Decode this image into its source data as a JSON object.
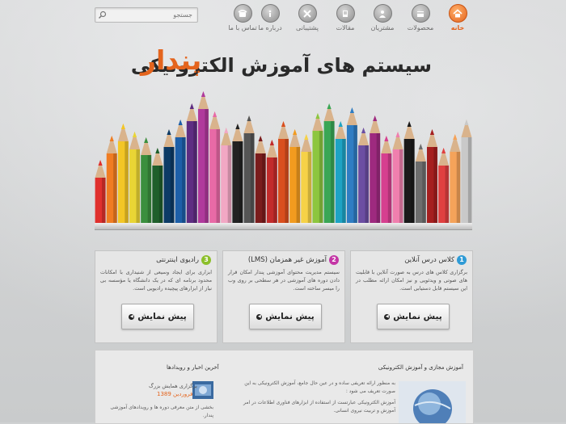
{
  "search": {
    "placeholder": "جستجو"
  },
  "nav": [
    {
      "id": "home",
      "label": "خانه",
      "icon": "home-icon",
      "active": true
    },
    {
      "id": "products",
      "label": "محصولات",
      "icon": "box-icon",
      "active": false
    },
    {
      "id": "customers",
      "label": "مشتریان",
      "icon": "users-icon",
      "active": false
    },
    {
      "id": "articles",
      "label": "مقالات",
      "icon": "article-icon",
      "active": false
    },
    {
      "id": "support",
      "label": "پشتیبانی",
      "icon": "tools-icon",
      "active": false
    },
    {
      "id": "about",
      "label": "درباره ما",
      "icon": "info-icon",
      "active": false
    },
    {
      "id": "contact",
      "label": "تماس با ما",
      "icon": "phone-icon",
      "active": false
    }
  ],
  "banner": {
    "title": "سیستم های آموزش الکترونیکی",
    "brand": "پندار"
  },
  "features": [
    {
      "num": "1",
      "title": "کلاس درس آنلاین",
      "desc": "برگزاری کلاس های درس به صورت آنلاین با قابلیت های صوتی و ویدئویی و نیز امکان ارائه مطلب در این سیستم قابل دستیابی است.",
      "button": "پیش نمایش",
      "color": "#2f9bd6"
    },
    {
      "num": "2",
      "title": "آموزش غیر همزمان (LMS)",
      "desc": "سیستم مدیریت محتوای آموزشی پندار امکان قرار دادن دوره های آموزشی در هر سطحی بر روی وب را میسر ساخته است.",
      "button": "پیش نمایش",
      "color": "#c436a6"
    },
    {
      "num": "3",
      "title": "رادیوی اینترنتی",
      "desc": "ابزاری برای ایجاد وسیعی از شنیداری با امکانات محدود برنامه ای که در یک دانشگاه یا مؤسسه بی نیاز از ابزارهای پیچیده رادیویی است.",
      "button": "پیش نمایش",
      "color": "#8cbf2a"
    }
  ],
  "bottom": {
    "left_title": "آخرین اخبار و رویدادها",
    "news_title": "برگزاری همایش بزرگ",
    "news_date": "فروردین 1389",
    "news_text": "بخشی از متن معرفی دوره ها و رویدادهای آموزشی پندار.",
    "right_title": "آموزش مجازی و آموزش الکترونیکی",
    "right_text_1": "به منظور ارائه تعریفی ساده و در عین حال جامع، آموزش الکترونیکی به این صورت تعریف می شود :",
    "right_text_2": "آموزش الکترونیکی عبارتست از استفاده از ابزارهای فناوری اطلاعات در امر آموزش و تربیت نیروی انسانی."
  }
}
